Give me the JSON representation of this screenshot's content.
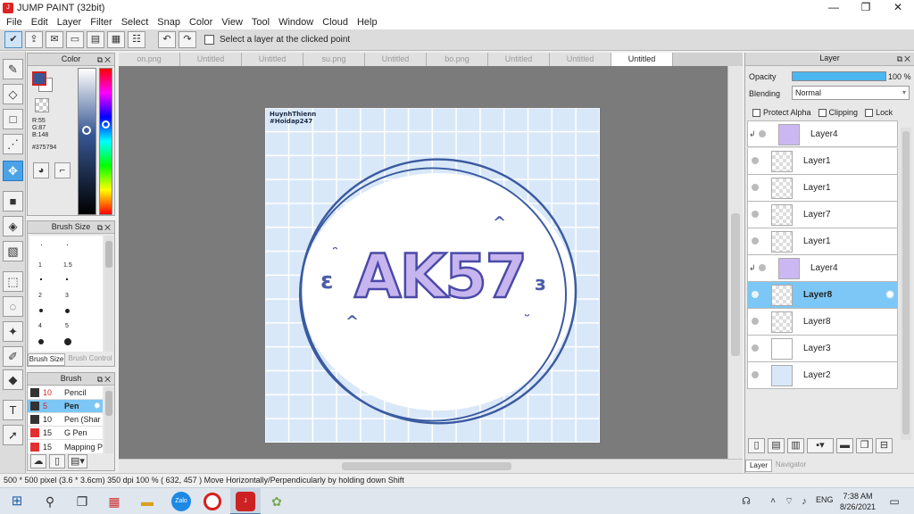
{
  "window": {
    "title": "JUMP PAINT (32bit)",
    "minimize": "—",
    "maximize": "❐",
    "close": "✕"
  },
  "menu": [
    "File",
    "Edit",
    "Layer",
    "Filter",
    "Select",
    "Snap",
    "Color",
    "View",
    "Tool",
    "Window",
    "Cloud",
    "Help"
  ],
  "toolbar": {
    "select_layer_label": "Select a layer at the clicked point"
  },
  "color_panel": {
    "title": "Color",
    "r": "R:55",
    "g": "G:87",
    "b": "B:148",
    "hex": "#375794",
    "main_color": "#375794"
  },
  "brush_size_panel": {
    "title": "Brush Size",
    "sizes": [
      "1",
      "1.5",
      "2",
      "3",
      "4",
      "5"
    ],
    "tab_active": "Brush Size",
    "tab_other": "Brush Control"
  },
  "brush_panel": {
    "title": "Brush",
    "items": [
      {
        "size": "10",
        "name": "Pencil",
        "color": "#333333"
      },
      {
        "size": "5",
        "name": "Pen",
        "color": "#333333"
      },
      {
        "size": "10",
        "name": "Pen (Shar",
        "color": "#333333"
      },
      {
        "size": "15",
        "name": "G Pen",
        "color": "#e23030"
      },
      {
        "size": "15",
        "name": "Mapping P",
        "color": "#e23030"
      }
    ]
  },
  "tabs": [
    "on.png",
    "Untitled",
    "Untitled",
    "su.png",
    "Untitled",
    "bo.png",
    "Untitled",
    "Untitled",
    "Untitled"
  ],
  "canvas": {
    "watermark_line1": "HuynhThienn",
    "watermark_line2": "#Hoidap247",
    "art_text": "AK57"
  },
  "layer_panel": {
    "title": "Layer",
    "opacity_label": "Opacity",
    "opacity_value": "100 %",
    "blending_label": "Blending",
    "blending_value": "Normal",
    "protect_alpha": "Protect Alpha",
    "clipping": "Clipping",
    "lock": "Lock",
    "layers": [
      "Layer4",
      "Layer1",
      "Layer1",
      "Layer7",
      "Layer1",
      "Layer4",
      "Layer8",
      "Layer8",
      "Layer3",
      "Layer2"
    ],
    "bottom_tab_active": "Layer",
    "bottom_tab_other": "Navigator"
  },
  "status": {
    "text": "500 * 500 pixel   (3.6 * 3.6cm)   350 dpi   100 %   ( 632, 457 )   Move Horizontally/Perpendicularly by holding down Shift"
  },
  "taskbar": {
    "time": "7:38 AM",
    "date": "8/26/2021",
    "lang": "ENG",
    "zalo": "Zalo"
  }
}
